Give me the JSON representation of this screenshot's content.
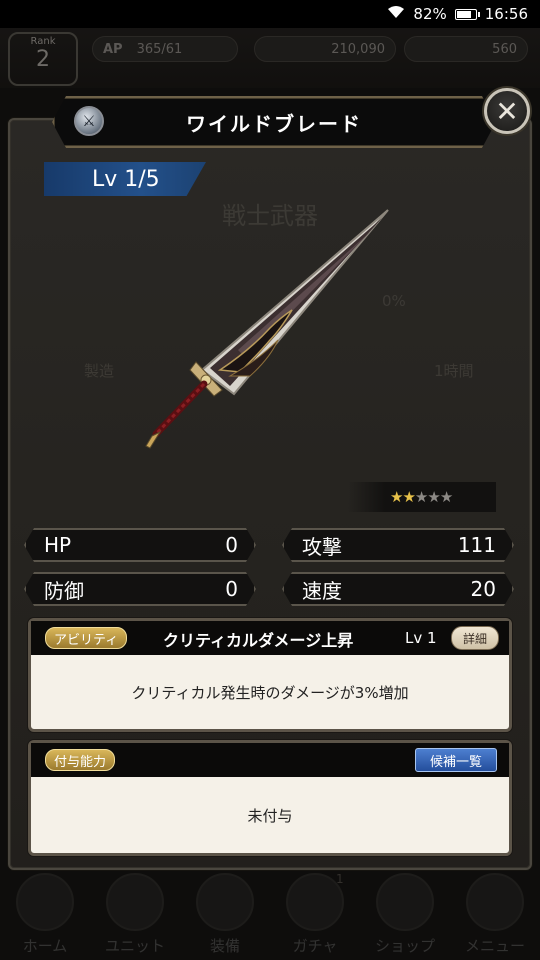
{
  "status_bar": {
    "battery": "82%",
    "time": "16:56"
  },
  "background": {
    "rank_label": "Rank",
    "rank_value": "2",
    "ap_label": "AP",
    "ap_value": "365/61",
    "coins": "210,090",
    "gems": "560",
    "ghost_texts": [
      "戦士武器",
      "0%",
      "製造",
      "1時間"
    ],
    "nav": [
      "ホーム",
      "ユニット",
      "装備",
      "ガチャ",
      "ショップ",
      "メニュー"
    ],
    "nav_badge": "1"
  },
  "dialog": {
    "title": "ワイルドブレード",
    "level": "Lv 1/5",
    "rarity": {
      "filled": 2,
      "total": 5
    },
    "stats": [
      {
        "label": "HP",
        "value": "0"
      },
      {
        "label": "攻撃",
        "value": "111"
      },
      {
        "label": "防御",
        "value": "0"
      },
      {
        "label": "速度",
        "value": "20"
      }
    ],
    "ability": {
      "tag": "アビリティ",
      "name": "クリティカルダメージ上昇",
      "level": "Lv 1",
      "detail_button": "詳細",
      "description": "クリティカル発生時のダメージが3%増加"
    },
    "enchant": {
      "tag": "付与能力",
      "list_button": "候補一覧",
      "value": "未付与"
    }
  },
  "colors": {
    "panel": "#2a2825",
    "banner_border": "#6e6148",
    "level_badge": "#23508a",
    "tag_gold": "#c9a44c",
    "star_filled": "#e8c24a",
    "card_background": "#f5f1e8"
  },
  "icons": [
    "wifi-icon",
    "battery-icon",
    "sword-emblem-icon",
    "close-icon",
    "star-icon",
    "weapon-art"
  ]
}
